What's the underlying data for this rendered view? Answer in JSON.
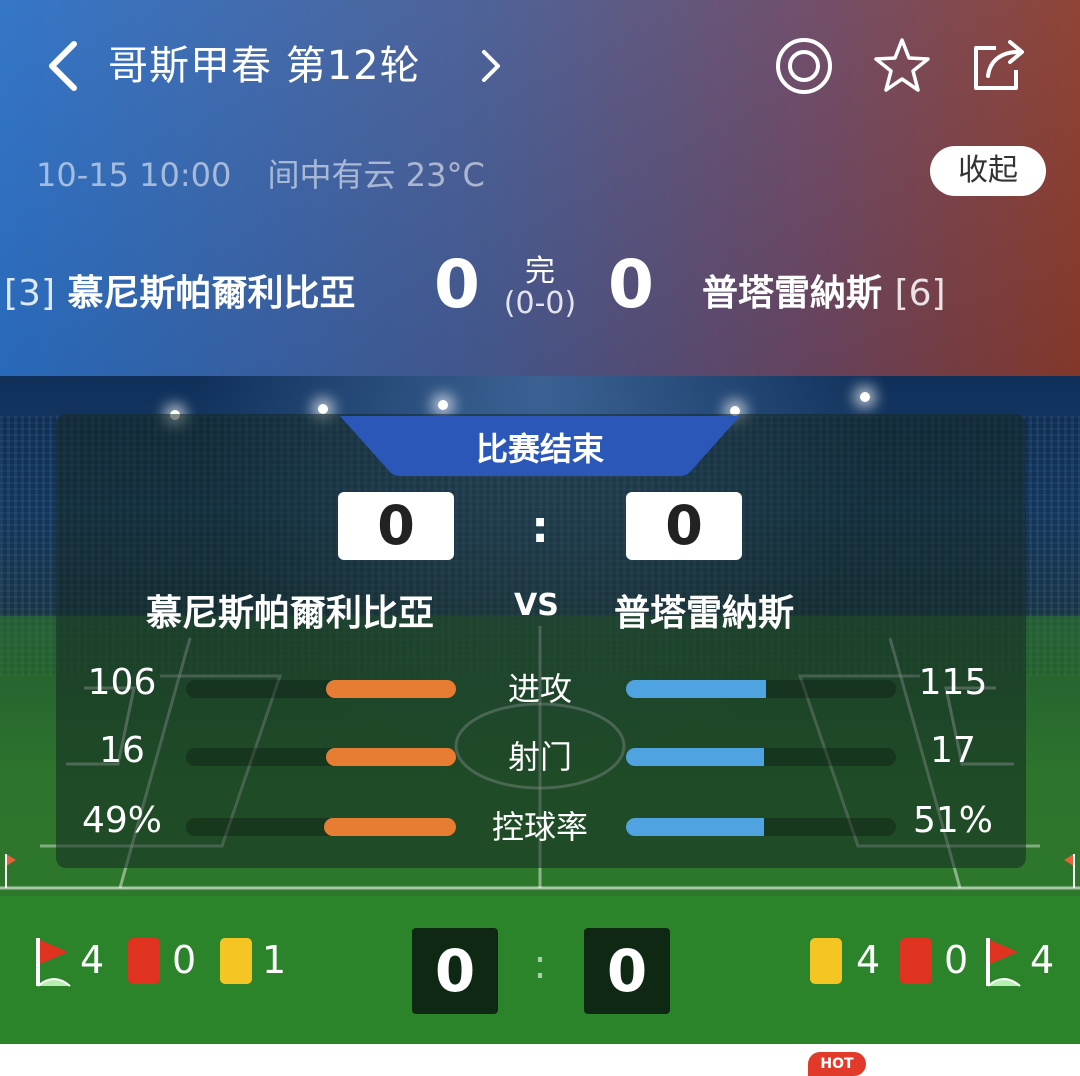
{
  "header": {
    "title": "哥斯甲春 第12轮",
    "datetime": "10-15 10:00",
    "weather": "间中有云 23°C",
    "collapse_label": "收起",
    "icons": [
      "back-icon",
      "chevron-right-icon",
      "target-icon",
      "star-icon",
      "share-icon"
    ]
  },
  "match": {
    "home": {
      "rank": "[3]",
      "name": "慕尼斯帕爾利比亞",
      "score": "0"
    },
    "away": {
      "rank": "[6]",
      "name": "普塔雷納斯",
      "score": "0"
    },
    "status": "完",
    "halftime": "(0-0)"
  },
  "panel": {
    "status_label": "比赛结束",
    "home_score": "0",
    "away_score": "0",
    "colon": ":",
    "home_name": "慕尼斯帕爾利比亞",
    "away_name": "普塔雷納斯",
    "vs": "VS",
    "stats": [
      {
        "label": "进攻",
        "home": "106",
        "away": "115",
        "home_ratio": 0.48,
        "away_ratio": 0.52
      },
      {
        "label": "射门",
        "home": "16",
        "away": "17",
        "home_ratio": 0.48,
        "away_ratio": 0.51
      },
      {
        "label": "控球率",
        "home": "49%",
        "away": "51%",
        "home_ratio": 0.49,
        "away_ratio": 0.51
      }
    ]
  },
  "summary": {
    "home": {
      "corners": "4",
      "red": "0",
      "yellow": "1"
    },
    "away": {
      "yellow": "4",
      "red": "0",
      "corners": "4"
    },
    "home_score": "0",
    "away_score": "0",
    "colon": ":"
  },
  "colors": {
    "home_bar": "#e67d32",
    "away_bar": "#4fa3e0",
    "panel_tab": "#2b58b8"
  },
  "hot_badge": "HOT"
}
